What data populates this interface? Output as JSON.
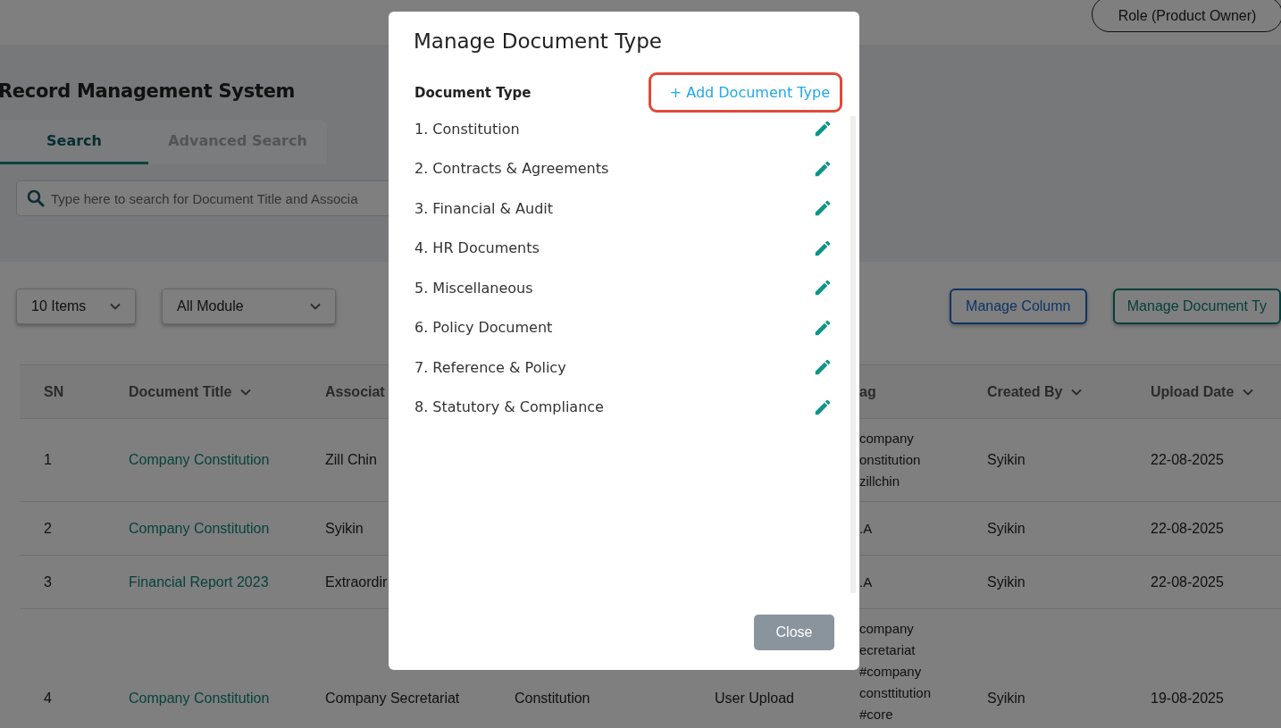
{
  "header": {
    "role_button": "Role (Product Owner)"
  },
  "page": {
    "title": "Record Management System",
    "tabs": [
      {
        "label": "Search",
        "selected": true
      },
      {
        "label": "Advanced Search",
        "selected": false
      }
    ],
    "search": {
      "placeholder": "Type here to search for Document Title and Associa"
    }
  },
  "toolbar": {
    "items_select": "10 Items",
    "module_select": "All Module",
    "manage_column": "Manage Column",
    "manage_document_type": "Manage Document Ty"
  },
  "table": {
    "header": {
      "sn": {
        "label": "SN"
      },
      "document_title": {
        "label": "Document Title",
        "sort": true
      },
      "column_3": {
        "label": "Associat"
      },
      "column_6": {
        "label": "ag"
      },
      "created_by": {
        "label": "Created By",
        "sort": true
      },
      "upload_date": {
        "label": "Upload Date",
        "sort": true
      }
    },
    "rows": [
      {
        "sn": "1",
        "document_title": "Company Constitution",
        "column_3": "Zill Chin",
        "column_6": [
          "company",
          "onstitution",
          "zillchin"
        ],
        "created_by": "Syikin",
        "upload_date": "22-08-2025"
      },
      {
        "sn": "2",
        "document_title": "Company Constitution",
        "column_3": "Syikin",
        "column_6": [
          ".A"
        ],
        "created_by": "Syikin",
        "upload_date": "22-08-2025"
      },
      {
        "sn": "3",
        "document_title": "Financial Report 2023",
        "column_3": "Extraordir",
        "column_6": [
          ".A"
        ],
        "created_by": "Syikin",
        "upload_date": "22-08-2025"
      },
      {
        "sn": "4",
        "document_title": "Company Constitution",
        "column_3": "Company Secretariat",
        "column_4": "Constitution",
        "column_5": "User Upload",
        "column_6": [
          "company",
          "ecretariat",
          "#company",
          "consttitution",
          "#core"
        ],
        "created_by": "Syikin",
        "upload_date": "19-08-2025"
      }
    ]
  },
  "modal": {
    "title": "Manage Document Type",
    "list_heading": "Document Type",
    "add_link": {
      "label": "+ Add Document Type",
      "highlighted": true
    },
    "items": [
      "1. Constitution",
      "2. Contracts & Agreements",
      "3. Financial & Audit",
      "4. HR Documents",
      "5. Miscellaneous",
      "6. Policy Document",
      "7. Reference & Policy",
      "8. Statutory & Compliance"
    ],
    "close_button": "Close"
  }
}
